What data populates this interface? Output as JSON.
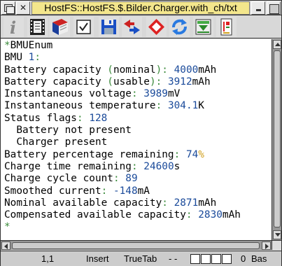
{
  "window": {
    "title": "HostFS::HostFS.$.Bilder.Charger.with_ch/txt"
  },
  "toolbar": {
    "buttons": [
      {
        "name": "info-icon"
      },
      {
        "name": "film-icon"
      },
      {
        "name": "book-icon"
      },
      {
        "name": "checkbox-icon"
      },
      {
        "name": "save-icon"
      },
      {
        "name": "swap-icon"
      },
      {
        "name": "diamond-icon"
      },
      {
        "name": "refresh-icon"
      },
      {
        "name": "download-icon"
      },
      {
        "name": "print-icon"
      }
    ]
  },
  "document": {
    "lines": [
      {
        "text": "*BMUEnum"
      },
      {
        "label": "BMU ",
        "value": "1",
        "sep": ":"
      },
      {
        "text": "Battery capacity (nominal): 4000mAh"
      },
      {
        "text": "Battery capacity (usable): 3912mAh"
      },
      {
        "text": "Instantaneous voltage: 3989mV"
      },
      {
        "text": "Instantaneous temperature: 304.1K"
      },
      {
        "text": "Status flags: 128"
      },
      {
        "text": "  Battery not present"
      },
      {
        "text": "  Charger present"
      },
      {
        "text": "Battery percentage remaining: 74%"
      },
      {
        "text": "Charge time remaining: 24600s"
      },
      {
        "text": "Charge cycle count: 89"
      },
      {
        "text": "Smoothed current: -148mA"
      },
      {
        "text": "Nominal available capacity: 2871mAh"
      },
      {
        "text": "Compensated available capacity: 2830mAh"
      },
      {
        "text": "*"
      }
    ]
  },
  "status": {
    "position": "1,1",
    "mode": "Insert",
    "tab": "TrueTab",
    "flags": "- -",
    "count": "0",
    "extra": "Bas"
  },
  "colors": {
    "value": "#1a4a9a",
    "separator": "#3a8a3a",
    "unit": "#d0a020",
    "title_bg": "#f3e68c"
  }
}
